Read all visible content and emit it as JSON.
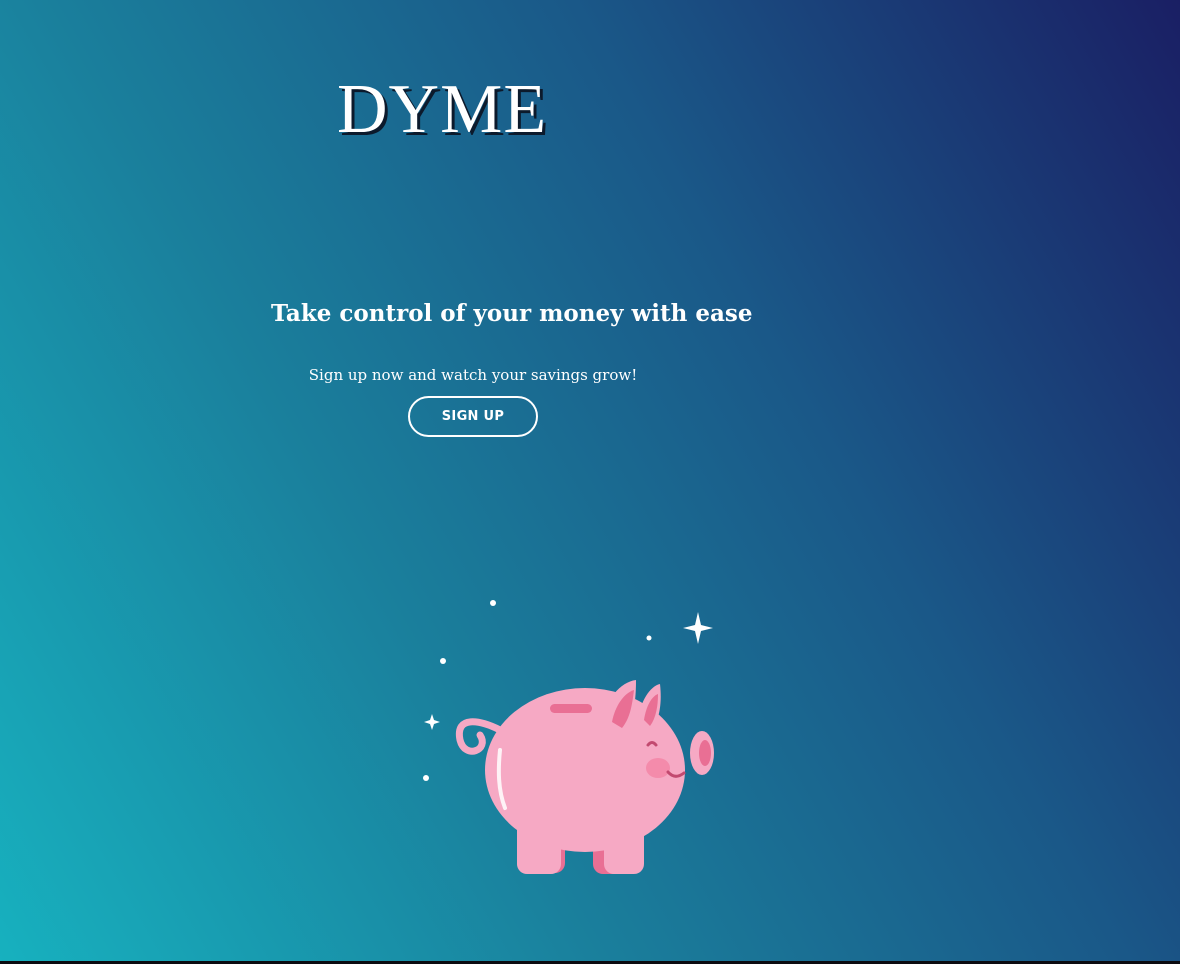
{
  "brand": {
    "logo_text": "DYME"
  },
  "hero": {
    "headline": "Take control of your money with ease",
    "subtext": "Sign up now and watch your savings grow!",
    "signup_label": "SIGN UP"
  },
  "illustration": {
    "icon": "piggy-bank-icon",
    "colors": {
      "body": "#f6a9c4",
      "accent": "#e96f94",
      "cheek": "#f48bab",
      "sparkle": "#ffffff"
    }
  },
  "theme": {
    "gradient_start": "#17b1bf",
    "gradient_end": "#1a1f64",
    "text_color": "#ffffff"
  }
}
